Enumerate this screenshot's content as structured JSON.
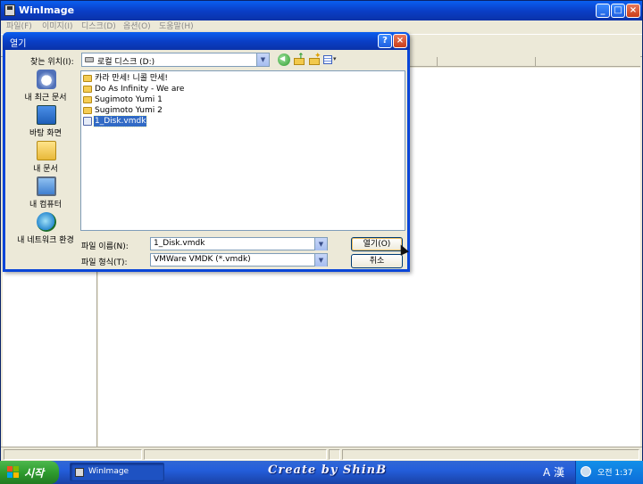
{
  "main_window": {
    "title": "WinImage",
    "menu": [
      "파일(F)",
      "이미지(I)",
      "디스크(D)",
      "옵션(O)",
      "도움말(H)"
    ],
    "window_buttons": {
      "minimize": "_",
      "maximize": "□",
      "close": "×"
    }
  },
  "open_dialog": {
    "title": "열기",
    "help_button": "?",
    "close_button": "×",
    "look_in_label": "찾는 위치(I):",
    "look_in_value": "로컬 디스크 (D:)",
    "places": [
      "내 최근 문서",
      "바탕 화면",
      "내 문서",
      "내 컴퓨터",
      "내 네트워크 환경"
    ],
    "files": [
      {
        "name": "카라 만세! 니콜 만세!",
        "type": "folder",
        "selected": false
      },
      {
        "name": "Do As Infinity - We are",
        "type": "folder",
        "selected": false
      },
      {
        "name": "Sugimoto Yumi 1",
        "type": "folder",
        "selected": false
      },
      {
        "name": "Sugimoto Yumi 2",
        "type": "folder",
        "selected": false
      },
      {
        "name": "1_Disk.vmdk",
        "type": "file",
        "selected": true
      }
    ],
    "file_name_label": "파일 이름(N):",
    "file_name_value": "1_Disk.vmdk",
    "file_type_label": "파일 형식(T):",
    "file_type_value": "VMWare VMDK (*.vmdk)",
    "open_button": "열기(O)",
    "cancel_button": "취소"
  },
  "taskbar": {
    "start_label": "시작",
    "task_button": "WinImage",
    "watermark": "Create by ShinB",
    "ime": "A 漢",
    "clock": "오전 1:37"
  },
  "colors": {
    "title_blue": "#0a3fc7",
    "selection": "#316ac5",
    "dialog_face": "#ece9d8"
  }
}
